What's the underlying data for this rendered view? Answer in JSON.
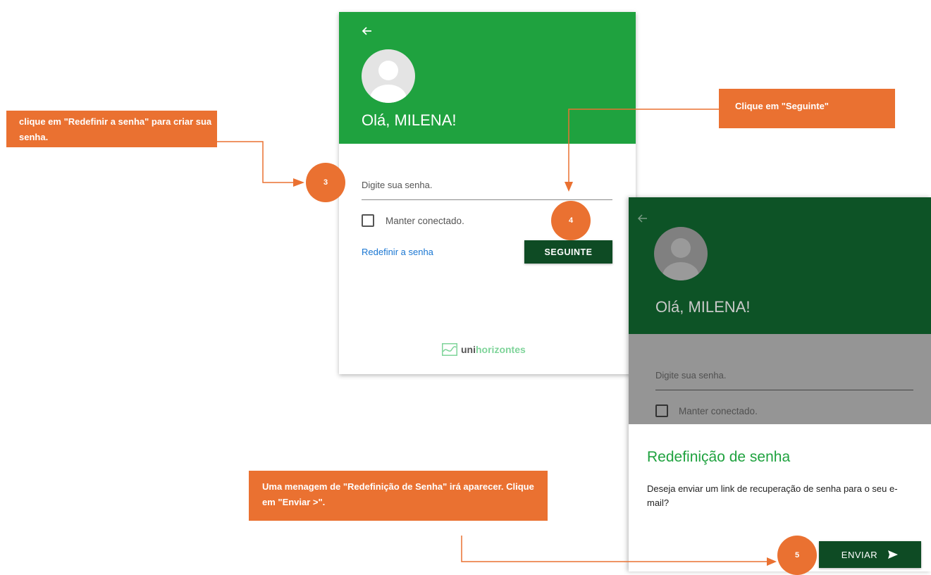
{
  "login_card": {
    "greeting": "Olá, MILENA!",
    "password_placeholder": "Digite sua senha.",
    "keep_connected_label": "Manter conectado.",
    "reset_link": "Redefinir a senha",
    "next_button": "SEGUINTE",
    "logo": {
      "prefix": "uni",
      "suffix": "horizontes"
    },
    "icons": [
      "back-arrow-icon",
      "user-avatar-icon",
      "checkbox-icon",
      "logo-wave-icon"
    ]
  },
  "reset_card": {
    "greeting": "Olá, MILENA!",
    "password_placeholder": "Digite sua senha.",
    "keep_connected_label": "Manter conectado.",
    "dialog": {
      "title": "Redefinição de senha",
      "message": "Deseja enviar um link de recuperação de senha para o seu e-mail?",
      "send_button": "ENVIAR"
    },
    "icons": [
      "back-arrow-icon",
      "user-avatar-icon",
      "checkbox-icon",
      "send-icon"
    ]
  },
  "annotations": {
    "callout_reset": "clique em \"Redefinir a senha\" para criar sua senha.",
    "callout_next": "Clique em \"Seguinte\"",
    "callout_dialog": "Uma menagem de \"Redefinição de Senha\" irá aparecer. Clique em \"Enviar >\".",
    "steps": [
      "3",
      "4",
      "5"
    ]
  },
  "colors": {
    "header_green": "#1fa23f",
    "dark_green": "#0e4b24",
    "link_blue": "#1976d2",
    "annotation_orange": "#ea7131"
  }
}
